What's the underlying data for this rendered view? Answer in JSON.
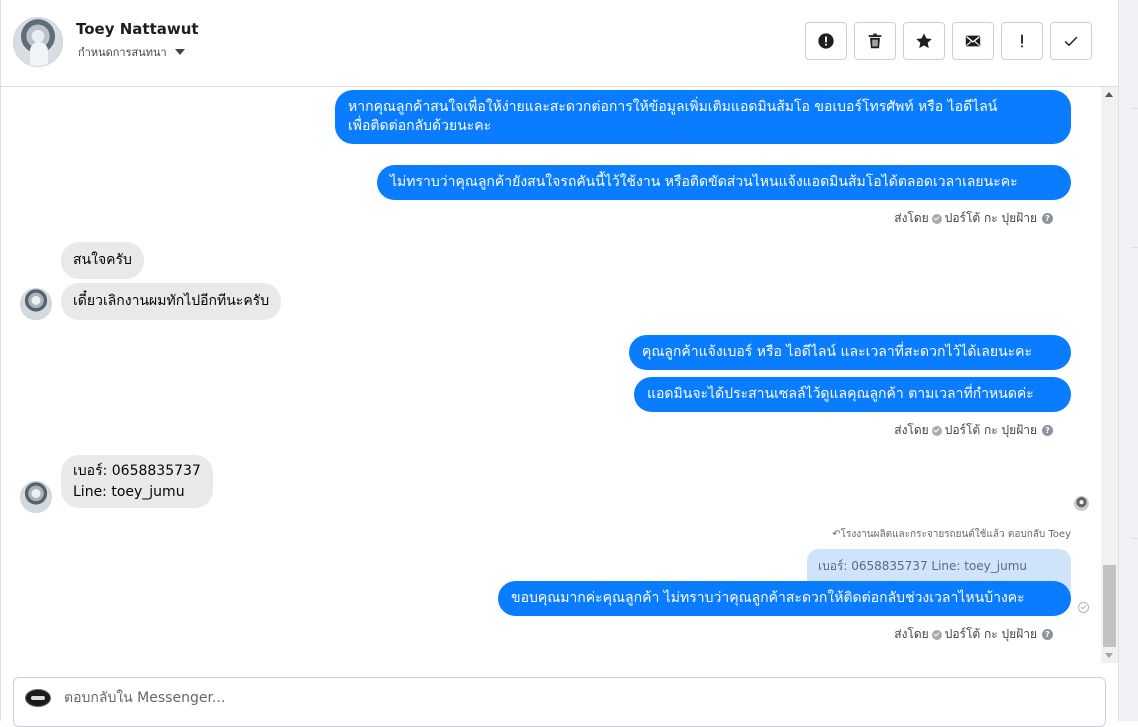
{
  "header": {
    "contact_name": "Toey Nattawut",
    "assign_label": "กำหนดการสนทนา",
    "actions": [
      {
        "name": "report-spam",
        "icon": "alert-circle-icon"
      },
      {
        "name": "delete",
        "icon": "trash-icon"
      },
      {
        "name": "star",
        "icon": "star-icon"
      },
      {
        "name": "mark-unread",
        "icon": "envelope-icon"
      },
      {
        "name": "mark-important",
        "icon": "exclamation-icon"
      },
      {
        "name": "mark-done",
        "icon": "checkmark-icon"
      }
    ]
  },
  "messages": {
    "m1_line1": "หากคุณลูกค้าสนใจเพื่อให้ง่ายและสะดวกต่อการให้ข้อมูลเพิ่มเติมแอดมินส้มโอ ขอเบอร์โทรศัพท์ หรือ ไอดีไลน์",
    "m1_line2": "เพื่อติดต่อกลับด้วยนะคะ",
    "m2": "ไม่ทราบว่าคุณลูกค้ายังสนใจรถคันนี้ไว้ใช้งาน หรือติดขัดส่วนไหนแจ้งแอดมินส้มโอได้ตลอดเวลาเลยนะคะ",
    "sent_by_1": "ส่งโดย",
    "sender_1": "ปอร์โต้ กะ ปุยฝ้าย",
    "in1": "สนใจครับ",
    "in2": "เดี๋ยวเลิกงานผมทักไปอีกทีนะครับ",
    "m3": "คุณลูกค้าแจ้งเบอร์ หรือ ไอดีไลน์ และเวลาที่สะดวกไว้ได้เลยนะคะ",
    "m4": "แอดมินจะได้ประสานเซลล์ไว้ดูแลคุณลูกค้า ตามเวลาที่กำหนดค่ะ",
    "sent_by_2": "ส่งโดย",
    "sender_2": "ปอร์โต้ กะ ปุยฝ้าย",
    "in3_line1": "เบอร์: 0658835737",
    "in3_line2": "Line: toey_jumu",
    "reply_note": "โรงงานผลิตและกระจายรถยนต์ใช้แล้ว ตอบกลับ Toey",
    "quote": "เบอร์: 0658835737 Line: toey_jumu",
    "m5": "ขอบคุณมากค่ะคุณลูกค้า ไม่ทราบว่าคุณลูกค้าสะดวกให้ติดต่อกลับช่วงเวลาไหนบ้างคะ",
    "sent_by_3": "ส่งโดย",
    "sender_3": "ปอร์โต้ กะ ปุยฝ้าย"
  },
  "composer": {
    "placeholder": "ตอบกลับใน Messenger..."
  },
  "colors": {
    "outgoing_bubble": "#0a7cff",
    "incoming_bubble": "#e9e9eb",
    "quote_bubble": "#cfe3fb"
  }
}
